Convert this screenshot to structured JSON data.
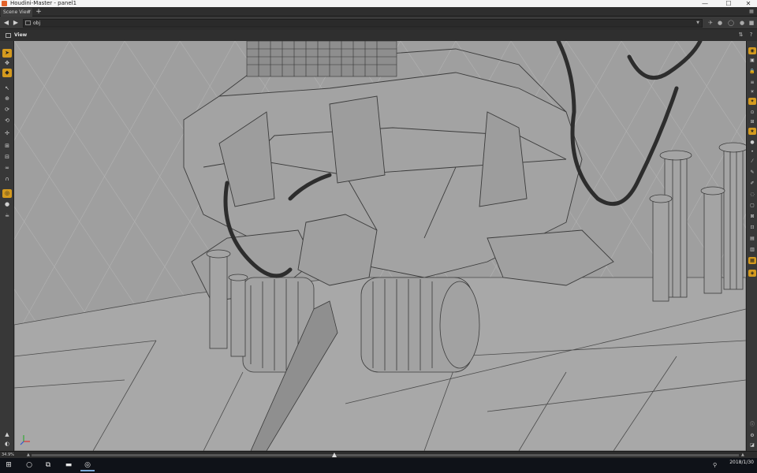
{
  "window": {
    "title": "Houdini-Master - panel1",
    "controls": {
      "minimize": "—",
      "maximize": "☐",
      "close": "✕"
    }
  },
  "tabbar": {
    "tab_label": "Scene View",
    "add_label": "+"
  },
  "pathbar": {
    "back": "◀",
    "forward": "▶",
    "path_value": "obj"
  },
  "panel": {
    "tab_label": "View"
  },
  "left_toolbar": {
    "tools": [
      "select-tool-icon",
      "transform-icon",
      "handle-icon",
      "pose-icon",
      "scale-icon",
      "rotate-icon",
      "rotate2-icon",
      "move-icon",
      "snap-icon",
      "snap2-icon",
      "lasso-icon",
      "magnet-icon",
      "target-icon",
      "sphere-icon",
      "teapot-icon",
      "camera-icon",
      "view-icon"
    ]
  },
  "right_toolbar": {
    "tools": [
      "display-icon",
      "shading-icon",
      "lock-icon",
      "layers-icon",
      "light-icon",
      "light2-icon",
      "camera-view-icon",
      "grid-icon",
      "star-icon",
      "sphere-icon",
      "dot-icon",
      "dot2-icon",
      "wand-icon",
      "brush-icon",
      "brush2-icon",
      "eye-icon",
      "box-icon",
      "box2-icon",
      "box3-icon",
      "box4-icon",
      "box5-icon",
      "box6-icon",
      "info-icon",
      "settings-icon",
      "bottom-icon"
    ]
  },
  "timeline": {
    "zoom": "34.9%"
  },
  "taskbar": {
    "time": "",
    "date": "2018/1/30"
  },
  "colors": {
    "accent": "#d49a1e",
    "viewport_bg": "#9f9f9f",
    "wire": "#3b3b3b"
  }
}
